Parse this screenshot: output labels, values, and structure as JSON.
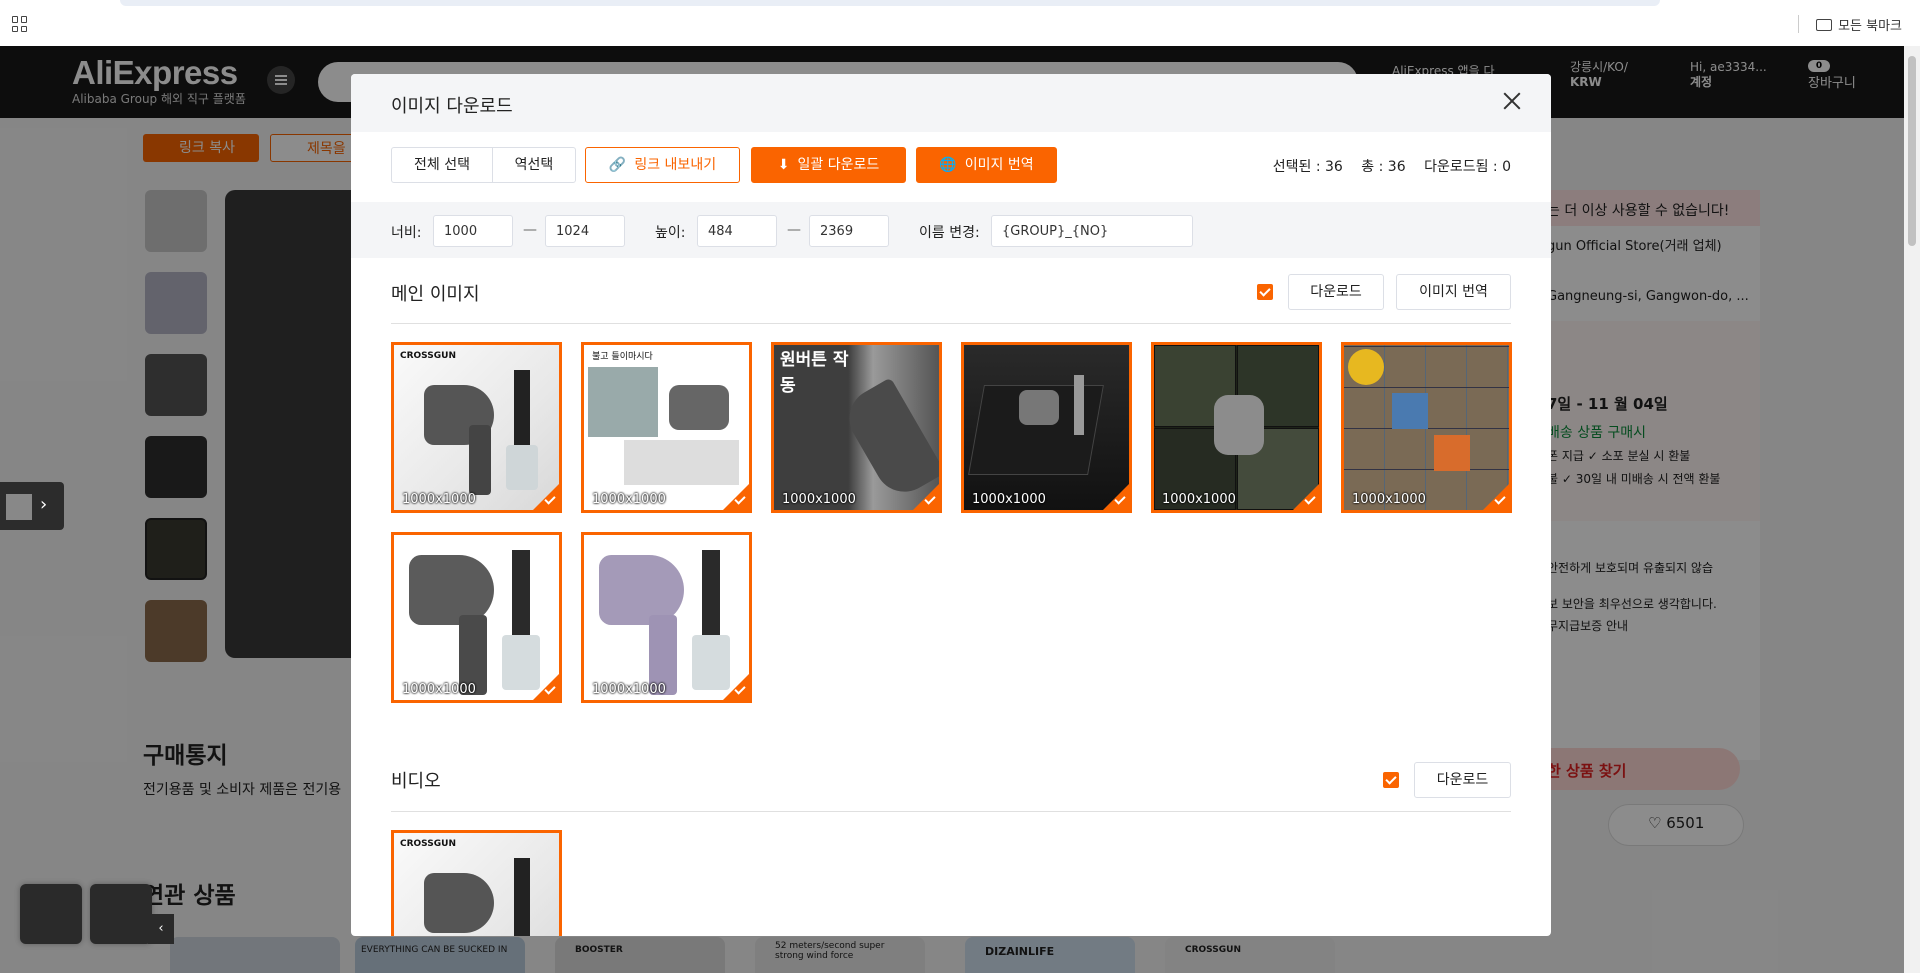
{
  "browser": {
    "bookmarks_label": "모든 북마크"
  },
  "header": {
    "logo_main": "AliExpress",
    "logo_sub": "Alibaba Group 해외 직구 플랫폼",
    "app_text": "AliExpress 앱을 다",
    "region_line1": "강릉시/KO/",
    "region_line2": "KRW",
    "account_line1": "Hi, ae3334...",
    "account_line2": "계정",
    "cart_count": "0",
    "cart_label": "장바구니"
  },
  "page": {
    "copy_link_button": "링크 복사",
    "copy_title_button": "제목을",
    "purchase_notice_title": "구매통지",
    "purchase_notice_text": "전기용품 및 소비자 제품은 전기용",
    "related_title": "연관 상품",
    "side_warning": "는 더 이상 사용할 수 없습니다!",
    "side_store": "gun Official Store(거래 업체)",
    "side_location": "Gangneung-si, Gangwon-do, ...",
    "side_delivery": "7일 - 11 월 04일",
    "side_guarantee": "배송 상품 구매시",
    "side_refund1": "폰 지급  ✓ 소포 분실 시 환불",
    "side_refund2": "불  ✓ 30일 내 미배송 시 전액 환불",
    "side_secure1": "안전하게 보호되며 유출되지 않습",
    "side_secure2": "보 보안을 최우선으로 생각합니다.",
    "side_secure3": "무지급보증 안내",
    "side_find": "한 상품 찾기",
    "wishlist_count": "6501",
    "banner_text1": "EVERYTHING CAN BE SUCKED IN",
    "banner_text2": "BOOSTER",
    "banner_text3": "52 meters/second super strong wind force",
    "banner_text4": "DIZAINLIFE",
    "banner_text5": "CROSSGUN"
  },
  "modal": {
    "title": "이미지 다운로드",
    "toolbar": {
      "select_all": "전체 선택",
      "invert_select": "역선택",
      "export_links": "링크 내보내기",
      "bulk_download": "일괄 다운로드",
      "translate_images": "이미지 번역"
    },
    "counts": {
      "selected": "선택된 : 36",
      "total": "총 : 36",
      "downloaded": "다운로드됨 : 0"
    },
    "filters": {
      "width_label": "너비:",
      "width_min": "1000",
      "width_max": "1024",
      "height_label": "높이:",
      "height_min": "484",
      "height_max": "2369",
      "rename_label": "이름 변경:",
      "rename_pattern": "{GROUP}_{NO}",
      "range_dash": "—"
    },
    "main_section": {
      "title": "메인 이미지",
      "download_button": "다운로드",
      "translate_button": "이미지 번역",
      "images": [
        {
          "size": "1000x1000",
          "caption": "CROSSGUN"
        },
        {
          "size": "1000x1000",
          "caption": "불고 들이마시다"
        },
        {
          "size": "1000x1000",
          "caption": "원버튼 작동"
        },
        {
          "size": "1000x1000",
          "caption": ""
        },
        {
          "size": "1000x1000",
          "caption": ""
        },
        {
          "size": "1000x1000",
          "caption": ""
        },
        {
          "size": "1000x1000",
          "caption": ""
        },
        {
          "size": "1000x1000",
          "caption": ""
        }
      ]
    },
    "video_section": {
      "title": "비디오",
      "download_button": "다운로드",
      "videos": [
        {
          "caption": "CROSSGUN"
        }
      ]
    }
  },
  "colors": {
    "accent": "#fa6400",
    "header_bg": "#191919"
  }
}
